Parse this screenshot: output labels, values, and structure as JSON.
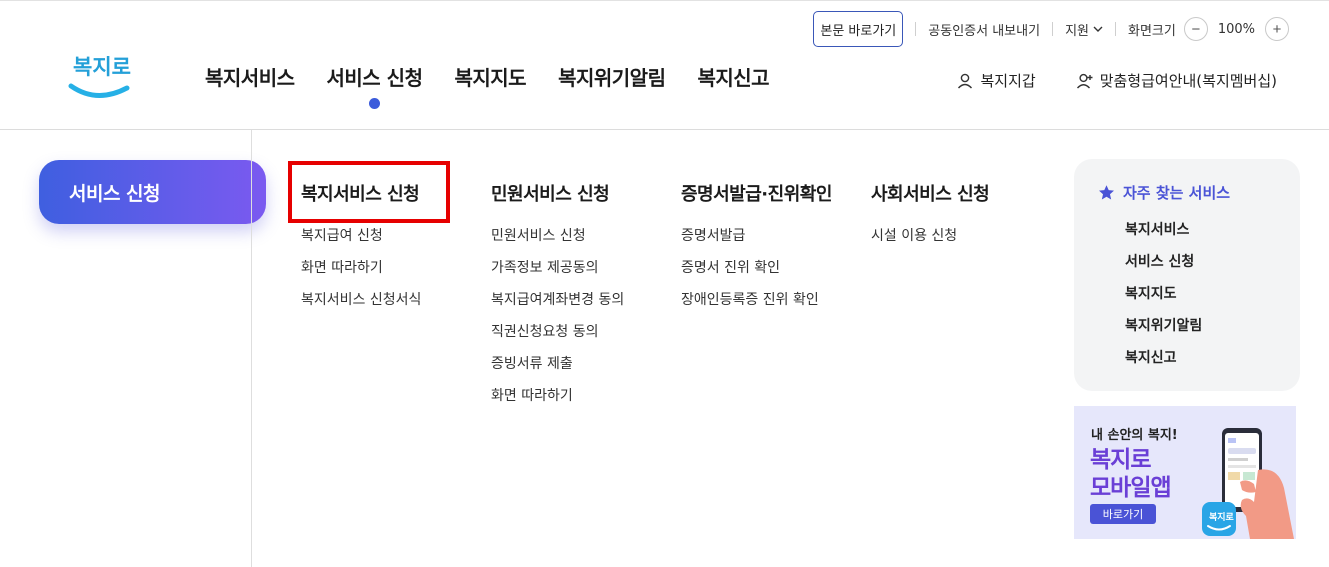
{
  "util": {
    "skip": "본문 바로가기",
    "cert": "공동인증서 내보내기",
    "support": "지원",
    "zoom_label": "화면크기",
    "zoom_minus": "−",
    "zoom_value": "100%",
    "zoom_plus": "+"
  },
  "logo": {
    "text": "복지로"
  },
  "gnb": [
    "복지서비스",
    "서비스 신청",
    "복지지도",
    "복지위기알림",
    "복지신고"
  ],
  "header_right": {
    "wallet": "복지지갑",
    "custom": "맞춤형급여안내(복지멤버십)"
  },
  "side": {
    "title": "서비스 신청"
  },
  "columns": [
    {
      "title": "복지서비스 신청",
      "items": [
        "복지급여 신청",
        "화면 따라하기",
        "복지서비스 신청서식"
      ]
    },
    {
      "title": "민원서비스 신청",
      "items": [
        "민원서비스 신청",
        "가족정보 제공동의",
        "복지급여계좌변경 동의",
        "직권신청요청 동의",
        "증빙서류 제출",
        "화면 따라하기"
      ]
    },
    {
      "title": "증명서발급·진위확인",
      "items": [
        "증명서발급",
        "증명서 진위 확인",
        "장애인등록증 진위 확인"
      ]
    },
    {
      "title": "사회서비스 신청",
      "items": [
        "시설 이용 신청"
      ]
    }
  ],
  "frequent": {
    "title": "자주 찾는 서비스",
    "items": [
      "복지서비스",
      "서비스 신청",
      "복지지도",
      "복지위기알림",
      "복지신고"
    ]
  },
  "banner": {
    "subtitle": "내 손안의 복지!",
    "title_line1": "복지로",
    "title_line2": "모바일앱",
    "button": "바로가기",
    "app_icon_text": "복지로"
  },
  "colors": {
    "accent": "#3b5bdb",
    "highlight": "#e60000",
    "purple": "#6a3fd6",
    "freq_title": "#4a53d6"
  }
}
